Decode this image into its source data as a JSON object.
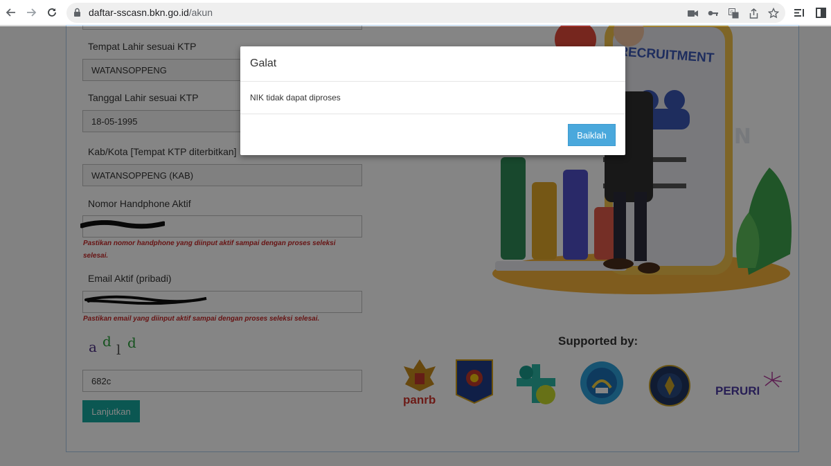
{
  "browser": {
    "url_host": "daftar-sscasn.bkn.go.id",
    "url_path": "/akun"
  },
  "form": {
    "birthplace_label": "Tempat Lahir sesuai KTP",
    "birthplace_value": "WATANSOPPENG",
    "birthdate_label": "Tanggal Lahir sesuai KTP",
    "birthdate_value": "18-05-1995",
    "city_label": "Kab/Kota [Tempat KTP diterbitkan]",
    "city_value": "WATANSOPPENG (KAB)",
    "phone_label": "Nomor Handphone Aktif",
    "phone_warning": "Pastikan nomor handphone yang diinput aktif sampai dengan proses seleksi selesai.",
    "email_label": "Email Aktif (pribadi)",
    "email_warning": "Pastikan email yang diinput aktif sampai dengan proses seleksi selesai.",
    "captcha_chars": [
      "a",
      "d",
      "l",
      "d"
    ],
    "captcha_value": "682c",
    "submit_label": "Lanjutkan"
  },
  "illustration": {
    "banner_text": "RECRUITMENT",
    "watermark": "SSCASN"
  },
  "supported": {
    "heading": "Supported by:",
    "logos": [
      {
        "name": "panrb",
        "text": "panrb"
      },
      {
        "name": "bkn",
        "text": ""
      },
      {
        "name": "kemenkes",
        "text": ""
      },
      {
        "name": "tut-wuri",
        "text": ""
      },
      {
        "name": "bssn",
        "text": ""
      },
      {
        "name": "peruri",
        "text": "PERURI"
      }
    ]
  },
  "modal": {
    "title": "Galat",
    "message": "NIK tidak dapat diproses",
    "ok_label": "Baiklah"
  },
  "colors": {
    "accent_button": "#16a79d",
    "modal_button": "#4aa8dc",
    "warning_text": "#c62828"
  }
}
